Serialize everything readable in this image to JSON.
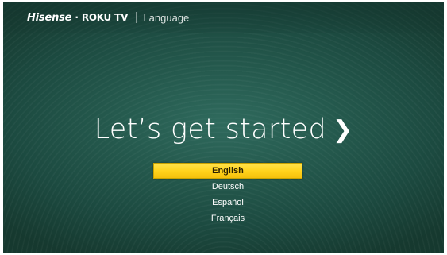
{
  "header": {
    "brand_hisense": "Hisense",
    "brand_dot": "·",
    "brand_roku": "ROKU",
    "brand_tv": "TV",
    "screen_title": "Language"
  },
  "main": {
    "headline": "Let’s get started",
    "headline_arrow": "❯"
  },
  "languages": [
    {
      "label": "English",
      "selected": true
    },
    {
      "label": "Deutsch",
      "selected": false
    },
    {
      "label": "Español",
      "selected": false
    },
    {
      "label": "Français",
      "selected": false
    }
  ],
  "colors": {
    "background": "#255a4e",
    "selection": "#ffd21a",
    "text": "#ffffff"
  }
}
